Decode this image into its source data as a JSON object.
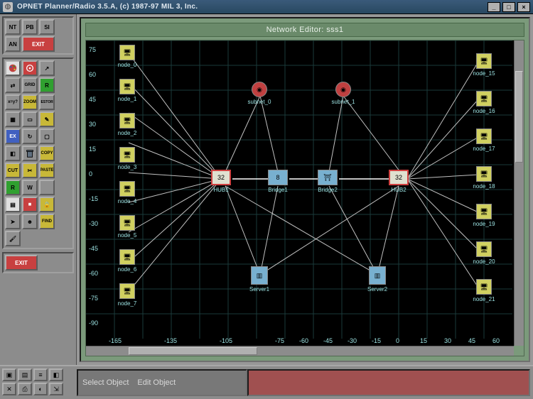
{
  "window": {
    "title": "OPNET Planner/Radio 3.5.A, (c) 1987-97 MIL 3, Inc.",
    "min_label": "_",
    "max_label": "□",
    "close_label": "×"
  },
  "toolboxes": {
    "a": {
      "nt": "NT",
      "pb": "PB",
      "si": "SI",
      "an": "AN",
      "exit": "EXIT"
    },
    "exit_main": "EXIT"
  },
  "editor": {
    "header": "Network Editor: sss1"
  },
  "axes": {
    "y": [
      75,
      60,
      45,
      30,
      15,
      0,
      -15,
      -30,
      -45,
      -60,
      -75,
      -90
    ],
    "x": [
      -165,
      -135,
      -105,
      -75,
      -60,
      -45,
      -30,
      -15,
      0,
      15,
      30,
      45,
      60
    ]
  },
  "nodes": {
    "left_ws": [
      {
        "n": "node_0"
      },
      {
        "n": "node_1"
      },
      {
        "n": "node_2"
      },
      {
        "n": "node_3"
      },
      {
        "n": "node_4"
      },
      {
        "n": "node_5"
      },
      {
        "n": "node_6"
      },
      {
        "n": "node_7"
      }
    ],
    "right_ws": [
      {
        "n": "node_15"
      },
      {
        "n": "node_16"
      },
      {
        "n": "node_17"
      },
      {
        "n": "node_18"
      },
      {
        "n": "node_19"
      },
      {
        "n": "node_20"
      },
      {
        "n": "node_21"
      }
    ],
    "subnet_0": "subnet_0",
    "subnet_1": "subnet_1",
    "hub1": {
      "label": "HUB1",
      "badge": "32"
    },
    "hub2": {
      "label": "HUB2",
      "badge": "32"
    },
    "bridge1": {
      "label": "Bridge1",
      "badge": "8"
    },
    "bridge2": "Bridge2",
    "server1": "Server1",
    "server2": "Server2"
  },
  "status": {
    "select_object": "Select Object",
    "edit_object": "Edit Object"
  },
  "colors": {
    "bg_canvas": "#000000",
    "grid": "#1a3a3a",
    "tick": "#9ae0e0",
    "chrome": "#8c8c8c",
    "header_green": "#6a8a6a",
    "accent_red": "#c84040",
    "accent_blue": "#78b0d0",
    "accent_yellow": "#d0d060"
  }
}
